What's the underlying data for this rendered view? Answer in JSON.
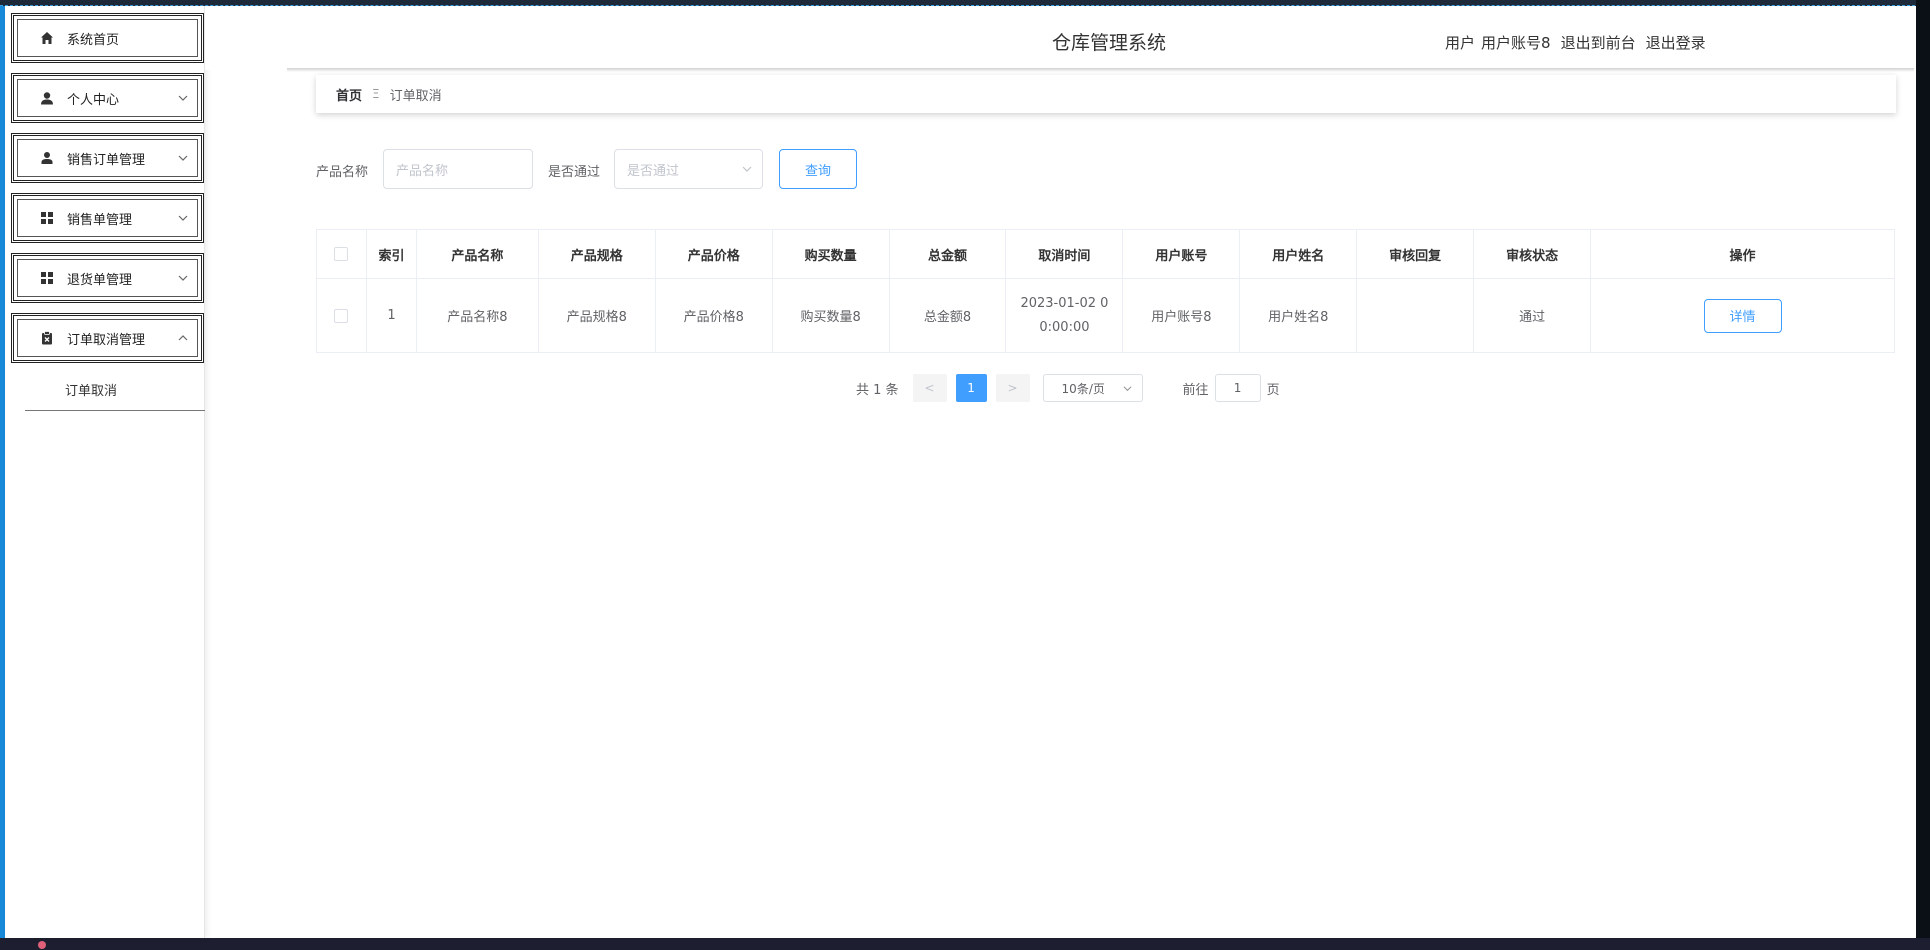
{
  "app": {
    "title": "仓库管理系统"
  },
  "header": {
    "user_role": "用户",
    "user_account": "用户账号8",
    "to_frontend": "退出到前台",
    "logout": "退出登录"
  },
  "sidebar": {
    "items": [
      {
        "label": "系统首页",
        "icon": "home-icon",
        "has_arrow": false
      },
      {
        "label": "个人中心",
        "icon": "user-icon",
        "has_arrow": true,
        "expanded": false
      },
      {
        "label": "销售订单管理",
        "icon": "user-icon",
        "has_arrow": true,
        "expanded": false
      },
      {
        "label": "销售单管理",
        "icon": "grid-icon",
        "has_arrow": true,
        "expanded": false
      },
      {
        "label": "退货单管理",
        "icon": "grid-icon",
        "has_arrow": true,
        "expanded": false
      },
      {
        "label": "订单取消管理",
        "icon": "clipboard-icon",
        "has_arrow": true,
        "expanded": true
      }
    ],
    "submenu": {
      "label": "订单取消"
    }
  },
  "breadcrumb": {
    "home": "首页",
    "separator": "Ξ",
    "current": "订单取消"
  },
  "search": {
    "product_label": "产品名称",
    "product_placeholder": "产品名称",
    "passed_label": "是否通过",
    "passed_placeholder": "是否通过",
    "query_button": "查询"
  },
  "table": {
    "headers": [
      "索引",
      "产品名称",
      "产品规格",
      "产品价格",
      "购买数量",
      "总金额",
      "取消时间",
      "用户账号",
      "用户姓名",
      "审核回复",
      "审核状态",
      "操作"
    ],
    "rows": [
      {
        "index": "1",
        "product_name": "产品名称8",
        "product_spec": "产品规格8",
        "product_price": "产品价格8",
        "quantity": "购买数量8",
        "total": "总金额8",
        "cancel_time_line1": "2023-01-02 0",
        "cancel_time_line2": "0:00:00",
        "user_account": "用户账号8",
        "user_name": "用户姓名8",
        "review_reply": "",
        "review_status": "通过",
        "action": "详情"
      }
    ]
  },
  "pagination": {
    "total": "共 1 条",
    "prev": "<",
    "current_page": "1",
    "next": ">",
    "page_size": "10条/页",
    "goto_label": "前往",
    "goto_value": "1",
    "goto_suffix": "页"
  },
  "colors": {
    "accent": "#409eff",
    "frame_blue": "#1789d8"
  }
}
